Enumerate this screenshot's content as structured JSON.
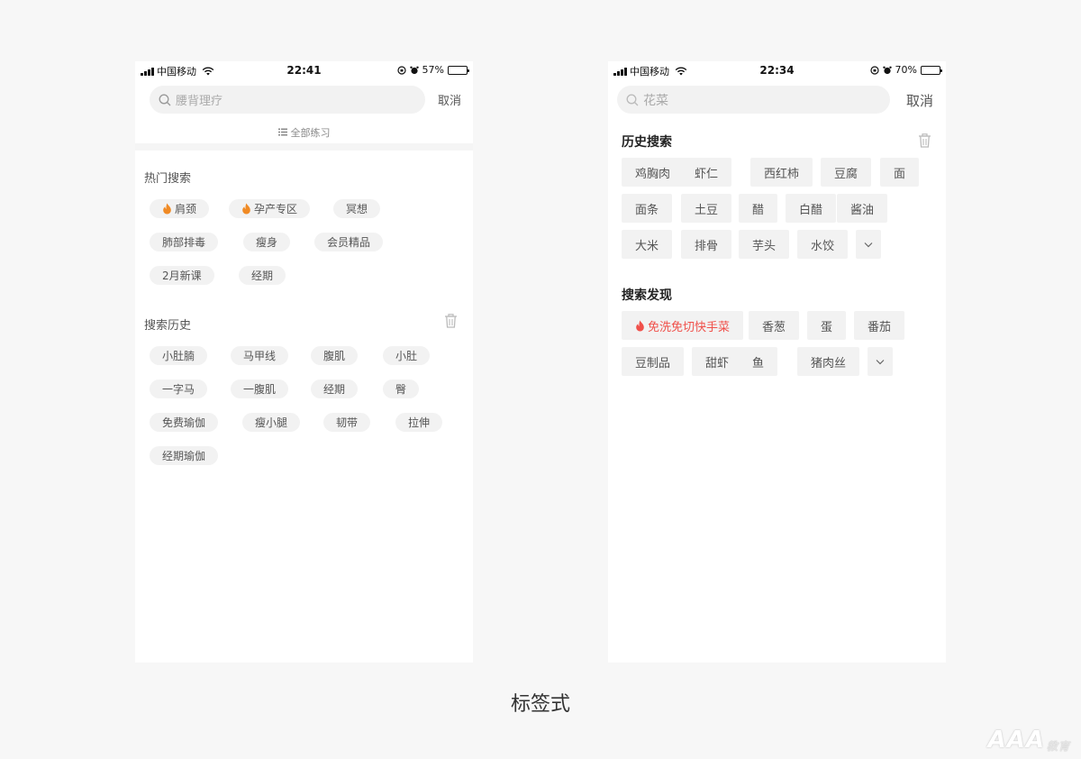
{
  "left_phone": {
    "status": {
      "carrier": "中国移动",
      "time": "22:41",
      "battery": "57%",
      "battery_level": 0.57
    },
    "search": {
      "placeholder": "腰背理疗",
      "cancel": "取消"
    },
    "filter": {
      "label": "全部练习",
      "icon": "list-icon"
    },
    "hot": {
      "title": "热门搜索",
      "tags": [
        {
          "label": "肩颈",
          "icon": "fire-icon"
        },
        {
          "label": "孕产专区",
          "icon": "fire-icon"
        },
        {
          "label": "冥想"
        },
        {
          "label": "肺部排毒"
        },
        {
          "label": "瘦身"
        },
        {
          "label": "会员精品"
        },
        {
          "label": "2月新课"
        },
        {
          "label": "经期"
        }
      ]
    },
    "history": {
      "title": "搜索历史",
      "delete_icon": "trash-icon",
      "tags": [
        {
          "label": "小肚腩"
        },
        {
          "label": "马甲线"
        },
        {
          "label": "腹肌"
        },
        {
          "label": "小肚"
        },
        {
          "label": "一字马"
        },
        {
          "label": "一腹肌"
        },
        {
          "label": "经期"
        },
        {
          "label": "臀"
        },
        {
          "label": "免费瑜伽"
        },
        {
          "label": "瘦小腿"
        },
        {
          "label": "韧带"
        },
        {
          "label": "拉伸"
        },
        {
          "label": "经期瑜伽"
        }
      ]
    }
  },
  "right_phone": {
    "status": {
      "carrier": "中国移动",
      "time": "22:34",
      "battery": "70%",
      "battery_level": 0.7
    },
    "search": {
      "placeholder": "花菜",
      "cancel": "取消"
    },
    "history": {
      "title": "历史搜索",
      "delete_icon": "trash-icon",
      "tags": [
        {
          "label": "鸡胸肉"
        },
        {
          "label": "虾仁"
        },
        {
          "label": "西红柿"
        },
        {
          "label": "豆腐"
        },
        {
          "label": "面"
        },
        {
          "label": "面条"
        },
        {
          "label": "土豆"
        },
        {
          "label": "醋"
        },
        {
          "label": "白醋"
        },
        {
          "label": "酱油"
        },
        {
          "label": "大米"
        },
        {
          "label": "排骨"
        },
        {
          "label": "芋头"
        },
        {
          "label": "水饺"
        },
        {
          "label": "",
          "icon": "chevron-down-icon"
        }
      ]
    },
    "discover": {
      "title": "搜索发现",
      "tags": [
        {
          "label": "免洗免切快手菜",
          "icon": "fire-icon",
          "hot": true
        },
        {
          "label": "香葱"
        },
        {
          "label": "蛋"
        },
        {
          "label": "番茄"
        },
        {
          "label": "豆制品"
        },
        {
          "label": "甜虾"
        },
        {
          "label": "鱼"
        },
        {
          "label": "猪肉丝"
        },
        {
          "label": "",
          "icon": "chevron-down-icon"
        }
      ]
    }
  },
  "caption": "标签式",
  "watermark": {
    "main": "AAA",
    "sub": "教育"
  },
  "colors": {
    "hot_text": "#f0504a",
    "fire_orange": "#f08a24",
    "fire_red": "#f0504a",
    "tag_bg": "#f2f2f2"
  }
}
